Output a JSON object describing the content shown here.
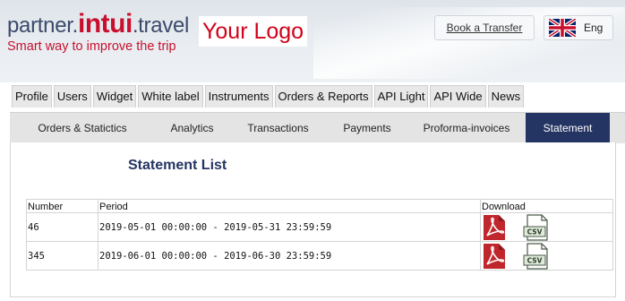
{
  "header": {
    "brand": {
      "prefix": "partner.",
      "accent": "intui",
      "suffix": ".travel"
    },
    "tagline": "Smart way to improve the trip",
    "partner_logo_text": "Your Logo",
    "book_transfer_label": "Book a Transfer",
    "language": {
      "label": "Eng",
      "flag_icon": "uk-flag-icon"
    }
  },
  "main_nav": {
    "items": [
      "Profile",
      "Users",
      "Widget",
      "White label",
      "Instruments",
      "Orders & Reports",
      "API Light",
      "API Wide",
      "News"
    ]
  },
  "sub_nav": {
    "tabs": [
      "Orders & Statictics",
      "Analytics",
      "Transactions",
      "Payments",
      "Proforma-invoices",
      "Statement"
    ],
    "active": "Statement"
  },
  "content": {
    "title": "Statement List",
    "table": {
      "columns": [
        "Number",
        "Period",
        "Download"
      ],
      "rows": [
        {
          "number": "46",
          "period": "2019-05-01 00:00:00 - 2019-05-31 23:59:59",
          "pdf_icon": "pdf-icon",
          "csv_icon": "csv-icon",
          "csv_label": "CSV"
        },
        {
          "number": "345",
          "period": "2019-06-01 00:00:00 - 2019-06-30 23:59:59",
          "pdf_icon": "pdf-icon",
          "csv_icon": "csv-icon",
          "csv_label": "CSV"
        }
      ]
    }
  },
  "colors": {
    "brand_navy": "#253563",
    "brand_red": "#c8102e",
    "logo_red": "#d0021b",
    "header_bg": "#e4e8ed",
    "tab_bg": "#e4e4e4"
  }
}
